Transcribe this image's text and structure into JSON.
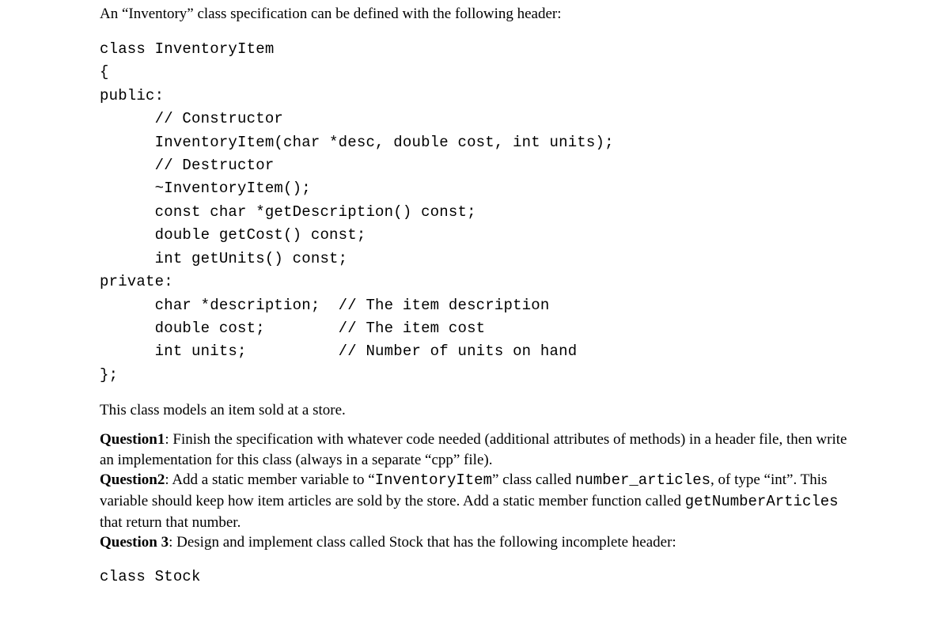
{
  "intro": "An “Inventory” class specification can be defined with the following header:",
  "code1": "class InventoryItem\n{\npublic:\n      // Constructor\n      InventoryItem(char *desc, double cost, int units);\n      // Destructor\n      ~InventoryItem();\n      const char *getDescription() const;\n      double getCost() const;\n      int getUnits() const;\nprivate:\n      char *description;  // The item description\n      double cost;        // The item cost\n      int units;          // Number of units on hand\n};",
  "para2": "This class models an item sold at a store.",
  "q1_label": "Question1",
  "q1_text_a": ": Finish the specification with whatever code needed (additional attributes of methods) in a header file, then write an implementation for this class (always in a separate “cpp” file).",
  "q2_label": "Question2",
  "q2_text_a": ": Add a static member variable to “",
  "q2_mono1": "InventoryItem",
  "q2_text_b": "” class called ",
  "q2_mono2": "number_articles",
  "q2_text_c": ", of type “int”. This variable should keep how item articles are sold by the store. Add a static member function called ",
  "q2_mono3": "getNumberArticles",
  "q2_text_d": " that return that number.",
  "q3_label": "Question 3",
  "q3_text": ": Design and implement class called Stock that has the following incomplete header:",
  "code2": "class Stock"
}
